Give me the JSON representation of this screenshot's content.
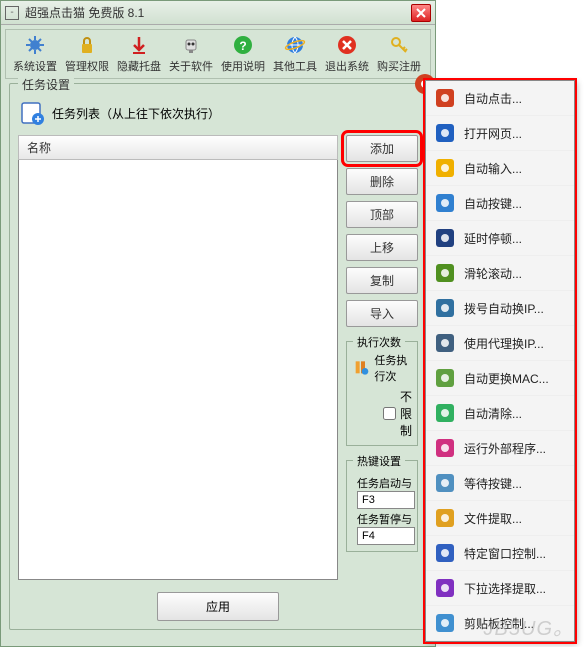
{
  "window": {
    "title": "超强点击猫 免费版 8.1"
  },
  "toolbar": [
    {
      "id": "system-settings",
      "label": "系统设置",
      "icon": "gear"
    },
    {
      "id": "manage-permissions",
      "label": "管理权限",
      "icon": "lock"
    },
    {
      "id": "hide-tray",
      "label": "隐藏托盘",
      "icon": "arrow-down"
    },
    {
      "id": "about-software",
      "label": "关于软件",
      "icon": "robot"
    },
    {
      "id": "usage-help",
      "label": "使用说明",
      "icon": "question"
    },
    {
      "id": "other-tools",
      "label": "其他工具",
      "icon": "ie"
    },
    {
      "id": "exit-system",
      "label": "退出系统",
      "icon": "x-red"
    },
    {
      "id": "buy-register",
      "label": "购买注册",
      "icon": "key"
    }
  ],
  "task_settings": {
    "fieldset_title": "任务设置",
    "list_title": "任务列表（从上往下依次执行）",
    "list_header": "名称",
    "buttons": {
      "add": "添加",
      "delete": "删除",
      "top": "顶部",
      "up": "上移",
      "copy": "复制",
      "import": "导入"
    },
    "exec": {
      "title": "执行次数",
      "label": "任务执行次",
      "unlimited": "不限制"
    },
    "hotkey": {
      "title": "热键设置",
      "start_label": "任务启动与",
      "start_value": "F3",
      "pause_label": "任务暂停与",
      "pause_value": "F4"
    },
    "apply": "应用"
  },
  "context_menu": [
    {
      "id": "auto-click",
      "label": "自动点击...",
      "color": "#d04020"
    },
    {
      "id": "open-webpage",
      "label": "打开网页...",
      "color": "#2060c0"
    },
    {
      "id": "auto-input",
      "label": "自动输入...",
      "color": "#f0b000"
    },
    {
      "id": "auto-keypress",
      "label": "自动按键...",
      "color": "#3080d0"
    },
    {
      "id": "delay-pause",
      "label": "延时停顿...",
      "color": "#204080"
    },
    {
      "id": "wheel-scroll",
      "label": "滑轮滚动...",
      "color": "#509020"
    },
    {
      "id": "dial-change-ip",
      "label": "拨号自动换IP...",
      "color": "#3070a0"
    },
    {
      "id": "proxy-change-ip",
      "label": "使用代理换IP...",
      "color": "#406080"
    },
    {
      "id": "auto-change-mac",
      "label": "自动更换MAC...",
      "color": "#60a040"
    },
    {
      "id": "auto-clear",
      "label": "自动清除...",
      "color": "#30b060"
    },
    {
      "id": "run-external",
      "label": "运行外部程序...",
      "color": "#d03080"
    },
    {
      "id": "wait-keypress",
      "label": "等待按键...",
      "color": "#5090c0"
    },
    {
      "id": "file-extract",
      "label": "文件提取...",
      "color": "#e0a020"
    },
    {
      "id": "window-control",
      "label": "特定窗口控制...",
      "color": "#3060c0"
    },
    {
      "id": "dropdown-extract",
      "label": "下拉选择提取...",
      "color": "#8030c0"
    },
    {
      "id": "clipboard-control",
      "label": "剪贴板控制...",
      "color": "#4090d0"
    }
  ],
  "anchor_icon_color": "#d04020",
  "watermark": "JB5UG。"
}
